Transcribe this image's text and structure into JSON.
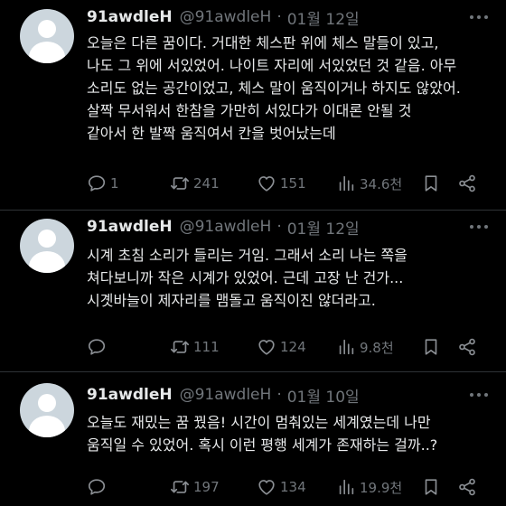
{
  "tweets": [
    {
      "name": "91awdleH",
      "handle": "@91awdleH",
      "separator": "·",
      "date": "01월 12일",
      "lines": [
        "오늘은 다른 꿈이다. 거대한 체스판 위에 체스 말들이 있고,",
        "나도 그 위에 서있었어. 나이트 자리에 서있었던 것 같음. 아무",
        "소리도 없는 공간이었고, 체스 말이 움직이거나 하지도 않았어.",
        "살짝 무서워서 한참을 가만히 서있다가 이대론 안될 것",
        "같아서 한 발짝 움직여서 칸을 벗어났는데"
      ],
      "replies": "1",
      "retweets": "241",
      "likes": "151",
      "views": "34.6천"
    },
    {
      "name": "91awdleH",
      "handle": "@91awdleH",
      "separator": "·",
      "date": "01월 12일",
      "lines": [
        "시계 초침 소리가 들리는 거임. 그래서 소리 나는 쪽을",
        "쳐다보니까 작은 시계가 있었어. 근데 고장 난 건가...",
        "시곗바늘이 제자리를 맴돌고 움직이진 않더라고."
      ],
      "replies": "",
      "retweets": "111",
      "likes": "124",
      "views": "9.8천"
    },
    {
      "name": "91awdleH",
      "handle": "@91awdleH",
      "separator": "·",
      "date": "01월 10일",
      "lines": [
        "오늘도 재밌는 꿈 꿨음! 시간이 멈춰있는 세계였는데 나만",
        "움직일 수 있었어. 혹시 이런 평행 세계가 존재하는 걸까..?"
      ],
      "replies": "",
      "retweets": "197",
      "likes": "134",
      "views": "19.9천"
    }
  ],
  "icons": {
    "reply": "reply-icon",
    "retweet": "retweet-icon",
    "like": "heart-icon",
    "views": "views-icon",
    "bookmark": "bookmark-icon",
    "share": "share-icon",
    "more": "more-icon"
  },
  "colors": {
    "background": "#000000",
    "text": "#e7e9ea",
    "secondary": "#71767b",
    "divider": "#2f3336"
  }
}
